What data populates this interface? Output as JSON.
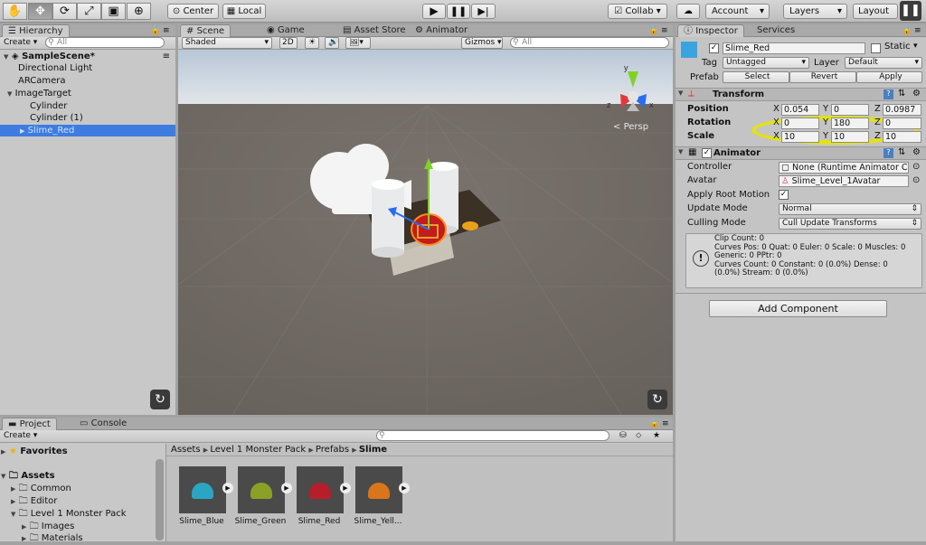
{
  "toolbar": {
    "tools": [
      "hand-tool",
      "move-tool",
      "rotate-tool",
      "scale-tool",
      "rect-tool",
      "transform-tool"
    ],
    "center_label": "Center",
    "local_label": "Local",
    "collab_label": "Collab ▾",
    "account_label": "Account",
    "layers_label": "Layers",
    "layout_label": "Layout"
  },
  "hierarchy": {
    "tab": "Hierarchy",
    "create_label": "Create ▾",
    "search_placeholder": "All",
    "scene_name": "SampleScene*",
    "items": [
      "Directional Light",
      "ARCamera",
      "ImageTarget",
      "Cylinder",
      "Cylinder (1)",
      "Slime_Red"
    ]
  },
  "scene": {
    "tabs": [
      "Scene",
      "Game",
      "Asset Store",
      "Animator"
    ],
    "shading_mode": "Shaded",
    "mode_2d": "2D",
    "gizmos_label": "Gizmos ▾",
    "search_placeholder": "All",
    "persp_label": "Persp"
  },
  "inspector": {
    "tabs": [
      "Inspector",
      "Services"
    ],
    "object_name": "Slime_Red",
    "static_label": "Static",
    "tag_label": "Tag",
    "tag_value": "Untagged",
    "layer_label": "Layer",
    "layer_value": "Default",
    "prefab_label": "Prefab",
    "prefab_buttons": [
      "Select",
      "Revert",
      "Apply"
    ],
    "transform": {
      "title": "Transform",
      "position_label": "Position",
      "rotation_label": "Rotation",
      "scale_label": "Scale",
      "position": {
        "x": "0.054",
        "y": "0",
        "z": "0.0987"
      },
      "rotation": {
        "x": "0",
        "y": "180",
        "z": "0"
      },
      "scale": {
        "x": "10",
        "y": "10",
        "z": "10"
      }
    },
    "animator": {
      "title": "Animator",
      "controller_label": "Controller",
      "controller_value": "None (Runtime Animator C",
      "avatar_label": "Avatar",
      "avatar_value": "Slime_Level_1Avatar",
      "root_motion_label": "Apply Root Motion",
      "update_mode_label": "Update Mode",
      "update_mode_value": "Normal",
      "culling_mode_label": "Culling Mode",
      "culling_mode_value": "Cull Update Transforms",
      "info_lines": [
        "Clip Count: 0",
        "Curves Pos: 0 Quat: 0 Euler: 0 Scale: 0 Muscles: 0",
        "Generic: 0 PPtr: 0",
        "Curves Count: 0 Constant: 0 (0.0%) Dense: 0",
        "(0.0%) Stream: 0 (0.0%)"
      ]
    },
    "add_component_label": "Add Component",
    "highlight_color": "#e6e600"
  },
  "project": {
    "tabs": [
      "Project",
      "Console"
    ],
    "create_label": "Create ▾",
    "favorites_label": "Favorites",
    "assets_label": "Assets",
    "tree": [
      "Common",
      "Editor",
      "Level 1 Monster Pack",
      "Images",
      "Materials"
    ],
    "breadcrumb": [
      "Assets",
      "Level 1 Monster Pack",
      "Prefabs",
      "Slime"
    ],
    "assets": [
      {
        "name": "Slime_Blue",
        "color": "#2aa6c4"
      },
      {
        "name": "Slime_Green",
        "color": "#8aa126"
      },
      {
        "name": "Slime_Red",
        "color": "#b81e2a"
      },
      {
        "name": "Slime_Yell...",
        "color": "#d9751a"
      }
    ]
  }
}
